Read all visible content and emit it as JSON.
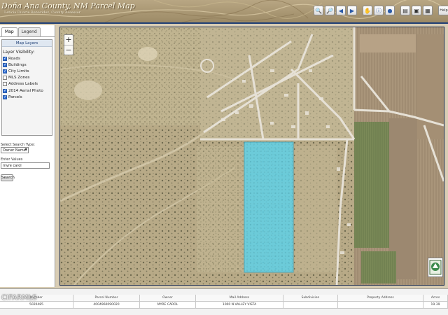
{
  "app": {
    "title": "Doña Ana County, NM Parcel Map",
    "subtitle": "Leticia Duarte Benavidez, County Assessor"
  },
  "toolbar": {
    "buttons": [
      {
        "icon": "zoom-in-icon"
      },
      {
        "icon": "zoom-out-icon"
      },
      {
        "icon": "back-icon"
      },
      {
        "icon": "forward-icon"
      },
      {
        "icon": "pan-icon"
      },
      {
        "icon": "identify-icon"
      },
      {
        "icon": "globe-icon"
      },
      {
        "icon": "print-icon"
      },
      {
        "icon": "save-icon"
      },
      {
        "icon": "measure-icon"
      }
    ],
    "help_label": "Help"
  },
  "sidebar": {
    "tabs": [
      {
        "label": "Map",
        "active": true
      },
      {
        "label": "Legend",
        "active": false
      }
    ],
    "panel_title": "Map Layers",
    "visibility_title": "Layer Visibility:",
    "layers": [
      {
        "label": "Roads",
        "checked": true
      },
      {
        "label": "Buildings",
        "checked": true
      },
      {
        "label": "City Limits",
        "checked": true
      },
      {
        "label": "MLS Zones",
        "checked": false
      },
      {
        "label": "Address Labels",
        "checked": false
      },
      {
        "label": "2014 Aerial Photo",
        "checked": true
      },
      {
        "label": "Parcels",
        "checked": true
      }
    ],
    "search_type_label": "Select Search Type:",
    "search_type_value": "Owner Name",
    "enter_values_label": "Enter Values",
    "search_value": "myre carol",
    "search_button": "Search"
  },
  "map": {
    "zoom_in": "+",
    "zoom_out": "−",
    "highlight_color": "#5fd1e8"
  },
  "results": {
    "headers": [
      "Number",
      "Parcel Number",
      "Owner",
      "Mail Address",
      "Subdivision",
      "Property Address",
      "Acres"
    ],
    "rows": [
      [
        "5020485",
        "4004960090020",
        "MYRE CAROL",
        "1000 N VALLEY VISTA",
        "",
        "",
        "19.39"
      ]
    ]
  },
  "watermark": "CIFARMLS"
}
